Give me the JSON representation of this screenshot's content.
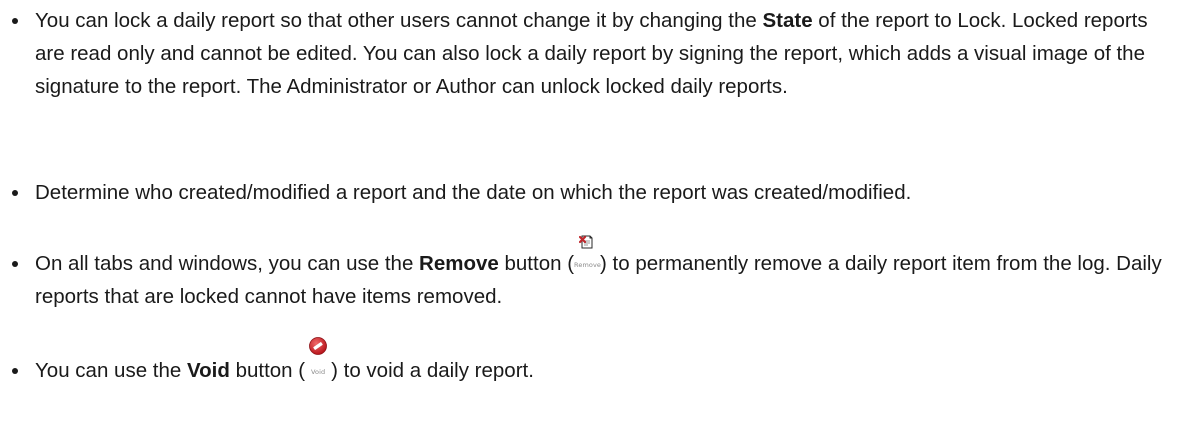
{
  "bullets": [
    {
      "text_a": "You can lock a daily report so that other users cannot change it by changing the ",
      "bold": "State",
      "text_b": " of the report to Lock. Locked reports are read only and cannot be edited. You can also lock a daily report by signing the report, which adds a visual image of the signature to the report. The Administrator or Author can unlock locked daily reports."
    },
    {
      "text": "Determine who created/modified a report and the date on which the report was created/modified."
    },
    {
      "text_a": "On all tabs and windows, you can use the ",
      "bold": "Remove",
      "text_b": " button (",
      "icon": {
        "name": "remove-icon",
        "caption": "Remove"
      },
      "text_c": ") to permanently remove a daily report item from the log. Daily reports that are locked cannot have items removed."
    },
    {
      "text_a": "You can use the ",
      "bold": "Void",
      "text_b": " button (",
      "icon": {
        "name": "void-icon",
        "caption": "Void"
      },
      "text_c": ") to void a daily report."
    }
  ]
}
